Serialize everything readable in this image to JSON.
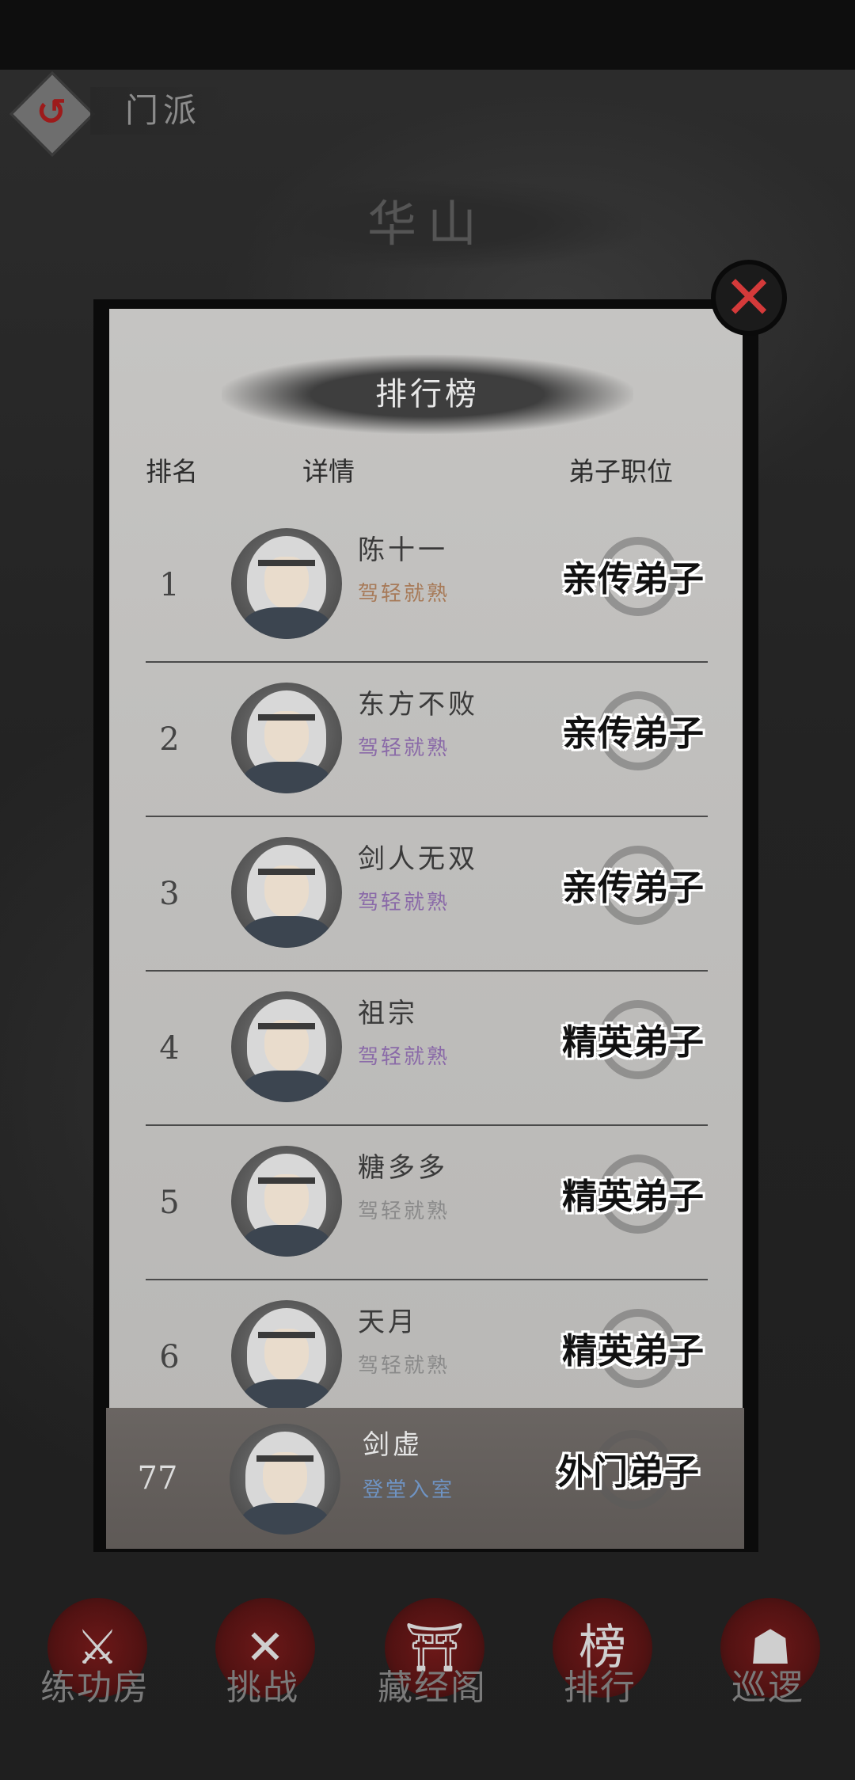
{
  "topbar": {
    "title": "门派"
  },
  "sect": {
    "name": "华山"
  },
  "board": {
    "title": "排行榜",
    "headers": {
      "rank": "排名",
      "details": "详情",
      "position": "弟子职位"
    }
  },
  "rows": [
    {
      "rank": "1",
      "name": "陈十一",
      "skill": "驾轻就熟",
      "skill_color": "#a77a58",
      "position": "亲传弟子"
    },
    {
      "rank": "2",
      "name": "东方不败",
      "skill": "驾轻就熟",
      "skill_color": "#8a6aa8",
      "position": "亲传弟子"
    },
    {
      "rank": "3",
      "name": "剑人无双",
      "skill": "驾轻就熟",
      "skill_color": "#8a6aa8",
      "position": "亲传弟子"
    },
    {
      "rank": "4",
      "name": "祖宗",
      "skill": "驾轻就熟",
      "skill_color": "#8a6aa8",
      "position": "精英弟子"
    },
    {
      "rank": "5",
      "name": "糖多多",
      "skill": "驾轻就熟",
      "skill_color": "#8a8a8a",
      "position": "精英弟子"
    },
    {
      "rank": "6",
      "name": "天月",
      "skill": "驾轻就熟",
      "skill_color": "#8a8a8a",
      "position": "精英弟子"
    }
  ],
  "self": {
    "rank": "77",
    "name": "剑虚",
    "skill": "登堂入室",
    "skill_color": "#6f94c4",
    "position": "外门弟子"
  },
  "nav": [
    {
      "label": "练功房",
      "icon": "martial-artist-icon",
      "glyph": "⚔"
    },
    {
      "label": "挑战",
      "icon": "crossed-swords-icon",
      "glyph": "✕"
    },
    {
      "label": "藏经阁",
      "icon": "pavilion-icon",
      "glyph": "⛩"
    },
    {
      "label": "排行",
      "icon": "scroll-icon",
      "glyph": "榜"
    },
    {
      "label": "巡逻",
      "icon": "guard-helmet-icon",
      "glyph": "☗"
    }
  ],
  "colors": {
    "accent_red": "#9d1b1b",
    "close_red": "#d43a3a",
    "panel_bg": "#c5c4c2"
  }
}
